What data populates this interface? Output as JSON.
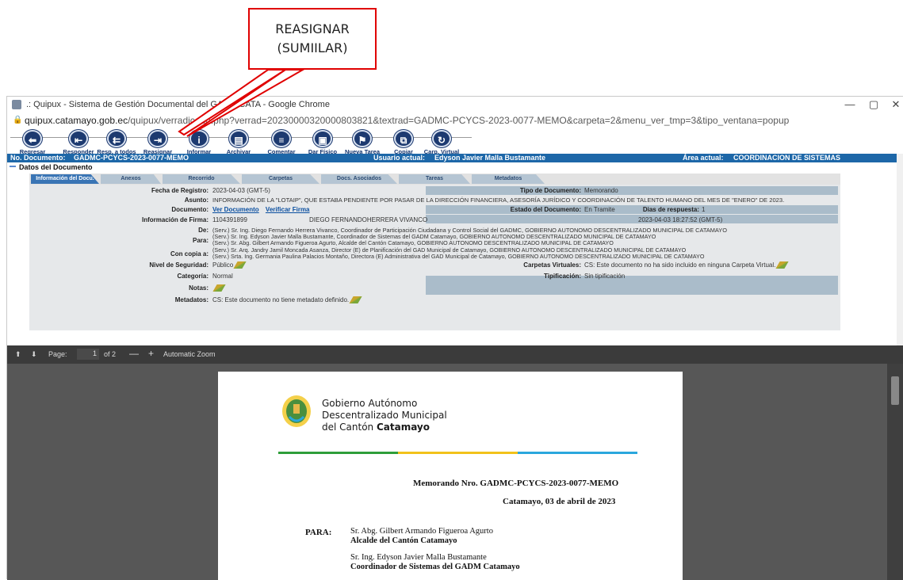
{
  "callout": {
    "line1": "REASIGNAR",
    "line2": "(SUMIILAR)"
  },
  "window": {
    "title": "Quipux - Sistema de Gestión Documental del GADM CATAMAYO - Google Chrome",
    "title_visible": ".: Quipux - Sistema de Gestión Documental del GADM CATA",
    "title_tail": "- Google Chrome",
    "url_host": "quipux.catamayo.gob.ec",
    "url_path": "/quipux/verradicado.php?verrad=20230000320000803821&textrad=GADMC-PCYCS-2023-0077-MEMO&carpeta=2&menu_ver_tmp=3&tipo_ventana=popup",
    "minimize": "—",
    "restore": "▢",
    "close": "✕"
  },
  "toolbar": [
    {
      "label": "Regresar",
      "icon": "back-arrow-icon",
      "glyph": "⬅"
    },
    {
      "label": "Responder",
      "icon": "reply-icon",
      "glyph": "⇤"
    },
    {
      "label": "Resp. a todos",
      "icon": "reply-all-icon",
      "glyph": "⇇"
    },
    {
      "label": "Reasignar",
      "icon": "reassign-icon",
      "glyph": "⇥"
    },
    {
      "label": "Informar",
      "icon": "info-icon",
      "glyph": "i"
    },
    {
      "label": "Archivar",
      "icon": "archive-icon",
      "glyph": "▤"
    },
    {
      "label": "Comentar",
      "icon": "comment-icon",
      "glyph": "≡"
    },
    {
      "label": "Dar Físico",
      "icon": "physical-doc-icon",
      "glyph": "▣"
    },
    {
      "label": "Nueva Tarea",
      "icon": "new-task-icon",
      "glyph": "⚑"
    },
    {
      "label": "Copiar",
      "icon": "copy-icon",
      "glyph": "⧉"
    },
    {
      "label": "Carp. Virtual",
      "icon": "virtual-folder-icon",
      "glyph": "↻"
    }
  ],
  "bluebar": {
    "doc_label": "No. Documento:",
    "doc_value": "GADMC-PCYCS-2023-0077-MEMO",
    "user_label": "Usuario actual:",
    "user_value": "Edyson Javier Malla Bustamante",
    "area_label": "Área actual:",
    "area_value": "COORDINACION DE SISTEMAS"
  },
  "section_title": "Datos del Documento",
  "tabs": [
    "Información del Docu.",
    "Anexos",
    "Recorrido",
    "Carpetas",
    "Docs. Asociados",
    "Tareas",
    "Metadatos"
  ],
  "form": {
    "fecha_registro_label": "Fecha de Registro:",
    "fecha_registro": "2023-04-03 (GMT-5)",
    "tipo_doc_label": "Tipo de Documento:",
    "tipo_doc": "Memorando",
    "asunto_label": "Asunto:",
    "asunto": "INFORMACIÓN DE LA \"LOTAIP\", QUE ESTABA PENDIENTE POR PASAR DE LA DIRECCIÓN FINANCIERA, ASESORÍA JURÍDICO Y COORDINACIÓN DE TALENTO HUMANO DEL MES DE \"ENERO\" DE 2023.",
    "documento_label": "Documento:",
    "ver_documento": "Ver Documento",
    "verificar_firma": "Verificar Firma",
    "estado_label": "Estado del Documento:",
    "estado": "En Tramite",
    "dias_label": "Dias de respuesta:",
    "dias": "1",
    "firma_label": "Información de Firma:",
    "firma_ci": "1104391899",
    "firma_nombre": "DIEGO FERNANDOHERRERA VIVANCO",
    "firma_fecha": "2023-04-03 18:27:52 (GMT-5)",
    "de_label": "De:",
    "de": "(Serv.) Sr. Ing. Diego Fernando Herrera Vivanco, Coordinador de Participación Ciudadana y Control Social del GADMC, GOBIERNO AUTONOMO DESCENTRALIZADO MUNICIPAL DE CATAMAYO",
    "para_label": "Para:",
    "para_1": "(Serv.) Sr. Ing. Edyson Javier Malla Bustamante, Coordinador de Sistemas del GADM Catamayo, GOBIERNO AUTONOMO DESCENTRALIZADO MUNICIPAL DE CATAMAYO",
    "para_2": "(Serv.) Sr. Abg. Gilbert Armando Figueroa Agurto, Alcalde del Cantón Catamayo, GOBIERNO AUTONOMO DESCENTRALIZADO MUNICIPAL DE CATAMAYO",
    "copia_label": "Con copia a:",
    "copia_1": "(Serv.) Sr. Arq. Jandry Jamil Moncada Asanza, Director (E) de Planificación del GAD Municipal de Catamayo, GOBIERNO AUTONOMO DESCENTRALIZADO MUNICIPAL DE CATAMAYO",
    "copia_2": "(Serv.) Srta. Ing. Germania Paulina Palacios Montaño, Directora (E) Administrativa del GAD Municipal de Catamayo, GOBIERNO AUTONOMO DESCENTRALIZADO MUNICIPAL DE CATAMAYO",
    "seguridad_label": "Nivel de Seguridad:",
    "seguridad": "Público",
    "carpetas_label": "Carpetas Virtuales:",
    "carpetas": "CS: Este documento no ha sido incluido en ninguna Carpeta Virtual.",
    "categoria_label": "Categoría:",
    "categoria": "Normal",
    "tipificacion_label": "Tipificación:",
    "tipificacion": "Sin tipificación",
    "notas_label": "Notas:",
    "metadatos_label": "Metadatos:",
    "metadatos": "CS: Este documento no tiene metadato definido."
  },
  "pdf": {
    "page_label": "Page:",
    "page_current": "1",
    "page_total": "of 2",
    "zoom": "Automatic Zoom",
    "org_line1": "Gobierno Autónomo",
    "org_line2": "Descentralizado Municipal",
    "org_line3a": "del Cantón ",
    "org_line3b": "Catamayo",
    "memo_number": "Memorando Nro. GADMC-PCYCS-2023-0077-MEMO",
    "memo_date": "Catamayo, 03 de abril de 2023",
    "para_label": "PARA:",
    "para1_name": "Sr. Abg. Gilbert Armando Figueroa Agurto",
    "para1_title": "Alcalde del Cantón Catamayo",
    "para2_name": "Sr. Ing. Edyson Javier Malla Bustamante",
    "para2_title": "Coordinador de Sistemas del GADM Catamayo"
  },
  "colors": {
    "brand_blue": "#1d67a8",
    "callout_red": "#e00000",
    "icon_navy": "#1d3a70",
    "stripe_green": "#2e9e3a",
    "stripe_yellow": "#f2c21a",
    "stripe_blue": "#2aa7dd"
  }
}
